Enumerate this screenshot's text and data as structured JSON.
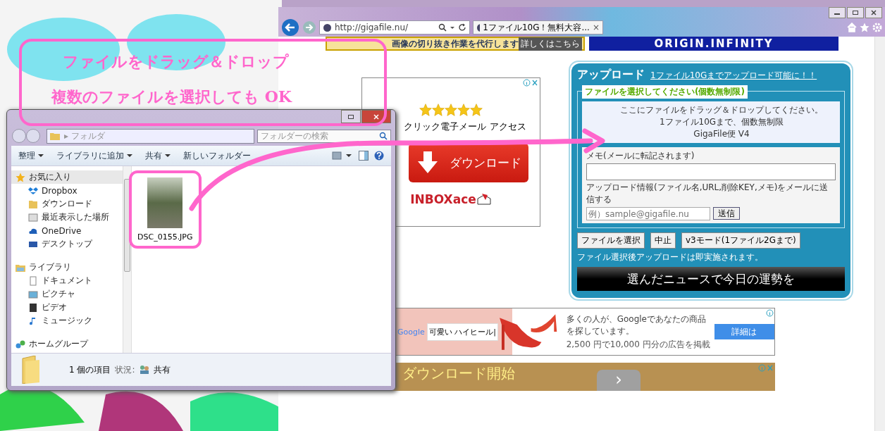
{
  "browser": {
    "address": "http://gigafile.nu/",
    "tab": {
      "title": "1ファイル10G！無料大容...",
      "close": "×"
    }
  },
  "page": {
    "top_banner": {
      "text": "画像の切り抜き作業を代行します",
      "link": "詳しくはこちら"
    },
    "logo_banner": "ORIGIN.INFINITY",
    "mail_ad": {
      "stars": 5,
      "text": "クリック電子メール アクセス",
      "button": "ダウンロード",
      "brand": "INBOXace"
    },
    "upload": {
      "title": "アップロード",
      "limit_link": "1ファイル10Gまでアップロード可能に！！",
      "legend": "ファイルを選択してください(個数無制限)",
      "drop_lines": [
        "ここにファイルをドラッグ＆ドロップしてください。",
        "1ファイル10Gまで、個数無制限",
        "GigaFile便 V4"
      ],
      "memo_label": "メモ(メールに転記されます)",
      "mail_label": "アップロード情報(ファイル名,URL,削除KEY,メモ)をメールに送信する",
      "mail_placeholder": "例）sample@gigafile.nu",
      "send": "送信",
      "buttons": [
        "ファイルを選択",
        "中止",
        "v3モード(1ファイル2Gまで)"
      ],
      "note": "ファイル選択後アップロードは即実施されます。",
      "news_banner": "選んだニュースで今日の運勢を"
    },
    "google_ad": {
      "logo": "Google",
      "query": "可愛い ハイヒール|",
      "headline": "多くの人が、Googleであなたの商品を探しています。",
      "offer": "2,500 円で10,000 円分の広告を掲載",
      "button": "詳細は"
    },
    "download_ad": {
      "text": "ダウンロード開始",
      "next": "›"
    }
  },
  "explorer": {
    "address": "▸ フォルダ",
    "search_placeholder": "フォルダーの検索",
    "toolbar": [
      {
        "label": "整理",
        "dropdown": true
      },
      {
        "label": "ライブラリに追加",
        "dropdown": true
      },
      {
        "label": "共有",
        "dropdown": true
      },
      {
        "label": "新しいフォルダー",
        "dropdown": false
      }
    ],
    "nav": [
      {
        "label": "お気に入り",
        "kind": "star",
        "selected": true,
        "children": [
          {
            "label": "Dropbox",
            "kind": "dropbox",
            "selected": false
          },
          {
            "label": "ダウンロード",
            "kind": "download",
            "selected": false
          },
          {
            "label": "最近表示した場所",
            "kind": "recent",
            "selected": false
          },
          {
            "label": "OneDrive",
            "kind": "cloud",
            "selected": false
          },
          {
            "label": "デスクトップ",
            "kind": "desktop",
            "selected": false
          }
        ]
      },
      {
        "label": "ライブラリ",
        "kind": "library",
        "selected": false,
        "children": [
          {
            "label": "ドキュメント",
            "kind": "document",
            "selected": false
          },
          {
            "label": "ピクチャ",
            "kind": "picture",
            "selected": false
          },
          {
            "label": "ビデオ",
            "kind": "video",
            "selected": false
          },
          {
            "label": "ミュージック",
            "kind": "music",
            "selected": false
          }
        ]
      },
      {
        "label": "ホームグループ",
        "kind": "homegroup",
        "selected": false
      }
    ],
    "files": [
      {
        "name": "DSC_0155.JPG"
      }
    ],
    "status": {
      "count": "1 個の項目",
      "state_label": "状況:",
      "state": "共有"
    }
  },
  "annotation": {
    "lines": [
      "ファイルをドラッグ＆ドロップ",
      "複数のファイルを選択しても OK"
    ]
  }
}
